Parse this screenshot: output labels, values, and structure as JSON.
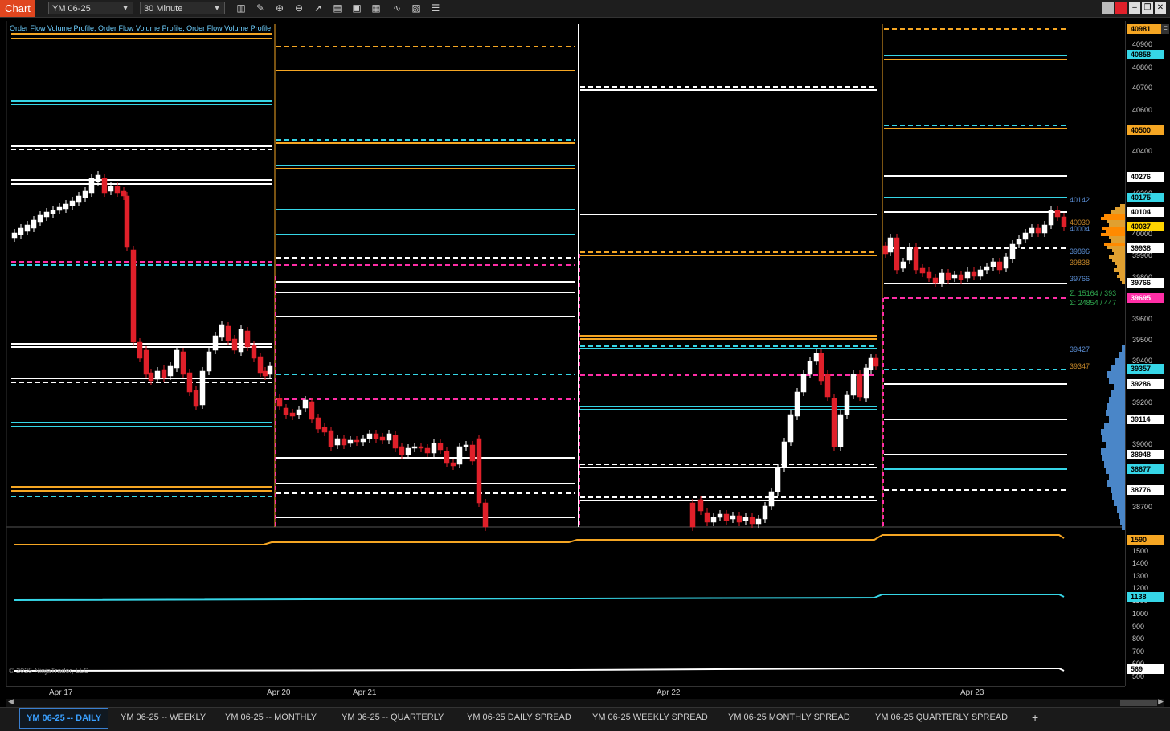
{
  "app": {
    "title": "Chart"
  },
  "toolbar": {
    "instrument": "YM 06-25",
    "interval": "30 Minute",
    "icons": [
      "bar-type-icon",
      "pencil-icon",
      "zoom-in-icon",
      "zoom-out-icon",
      "pointer-icon",
      "properties-icon",
      "template-icon",
      "strategies-icon",
      "indicators-icon",
      "data-box-icon",
      "menu-icon"
    ]
  },
  "indicator_label": "Order Flow Volume Profile, Order Flow Volume Profile, Order Flow Volume Profile",
  "copyright": "© 2025 NinjaTrader, LLC",
  "dates": [
    "Apr 17",
    "Apr 20",
    "Apr 21",
    "Apr 22",
    "Apr 23"
  ],
  "price_ticks": [
    "40900",
    "40800",
    "40700",
    "40600",
    "40400",
    "40300",
    "40000",
    "39900",
    "39800",
    "39600",
    "39500",
    "39400",
    "39200",
    "39000",
    "38700"
  ],
  "badges": [
    {
      "value": "40981",
      "color": "#f5a623",
      "text": "#000"
    },
    {
      "value": "40858",
      "color": "#36d6e7",
      "text": "#000"
    },
    {
      "value": "40500",
      "color": "#f5a623",
      "text": "#000"
    },
    {
      "value": "40276",
      "color": "#ffffff",
      "text": "#000"
    },
    {
      "value": "40175",
      "color": "#36d6e7",
      "text": "#000"
    },
    {
      "value": "40104",
      "color": "#ffffff",
      "text": "#000"
    },
    {
      "value": "40037",
      "color": "#ffd400",
      "text": "#000"
    },
    {
      "value": "39938",
      "color": "#ffffff",
      "text": "#000"
    },
    {
      "value": "39766",
      "color": "#ffffff",
      "text": "#000"
    },
    {
      "value": "39695",
      "color": "#ff2ea6",
      "text": "#fff"
    },
    {
      "value": "39357",
      "color": "#36d6e7",
      "text": "#000"
    },
    {
      "value": "39286",
      "color": "#ffffff",
      "text": "#000"
    },
    {
      "value": "39114",
      "color": "#ffffff",
      "text": "#000"
    },
    {
      "value": "38948",
      "color": "#ffffff",
      "text": "#000"
    },
    {
      "value": "38877",
      "color": "#36d6e7",
      "text": "#000"
    },
    {
      "value": "38776",
      "color": "#ffffff",
      "text": "#000"
    }
  ],
  "profile_labels": [
    {
      "value": "40142",
      "color": "#5b8fd6"
    },
    {
      "value": "40030",
      "color": "#c98a2a"
    },
    {
      "value": "40004",
      "color": "#5b8fd6"
    },
    {
      "value": "39896",
      "color": "#5b8fd6"
    },
    {
      "value": "39838",
      "color": "#c98a2a"
    },
    {
      "value": "39766",
      "color": "#5b8fd6"
    },
    {
      "value": "Σ: 15164 / 393",
      "color": "#2fa84f"
    },
    {
      "value": "Σ: 24854 / 447",
      "color": "#2fa84f"
    },
    {
      "value": "39427",
      "color": "#5b8fd6"
    },
    {
      "value": "39347",
      "color": "#c98a2a"
    }
  ],
  "lower_ticks": [
    "1500",
    "1400",
    "1300",
    "1200",
    "1100",
    "1000",
    "900",
    "800",
    "700",
    "600",
    "500"
  ],
  "lower_badges": [
    {
      "value": "1590",
      "color": "#f5a623",
      "text": "#000"
    },
    {
      "value": "1138",
      "color": "#36d6e7",
      "text": "#000"
    },
    {
      "value": "569",
      "color": "#ffffff",
      "text": "#000"
    }
  ],
  "tabs": [
    "YM 06-25 -- DAILY",
    "YM 06-25 -- WEEKLY",
    "YM 06-25 -- MONTHLY",
    "YM 06-25 -- QUARTERLY",
    "YM 06-25 DAILY SPREAD",
    "YM 06-25 WEEKLY SPREAD",
    "YM 06-25 MONTHLY SPREAD",
    "YM 06-25 QUARTERLY SPREAD"
  ],
  "add_tab": "+",
  "scale_flag": "F",
  "colors": {
    "orange": "#f5a623",
    "cyan": "#36d6e7",
    "magenta": "#ff2ea6",
    "white": "#ffffff",
    "up": "#ffffff",
    "down": "#e0202a",
    "profile": "#4a86c8"
  }
}
